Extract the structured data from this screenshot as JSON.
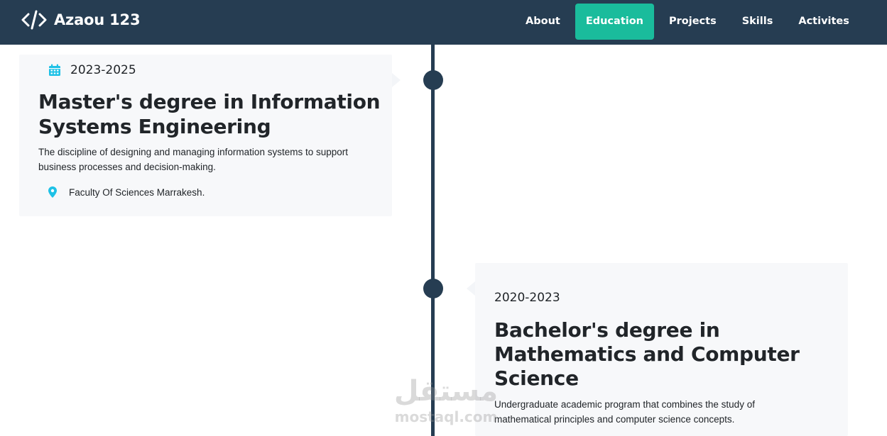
{
  "header": {
    "brand": "Azaou 123",
    "brand_icon": "code-icon",
    "nav": [
      {
        "label": "About",
        "active": false
      },
      {
        "label": "Education",
        "active": true
      },
      {
        "label": "Projects",
        "active": false
      },
      {
        "label": "Skills",
        "active": false
      },
      {
        "label": "Activites",
        "active": false
      }
    ]
  },
  "timeline": {
    "items": [
      {
        "date": "2023-2025",
        "date_icon": "calendar-icon",
        "title_lines": [
          "Master's degree in Information",
          "Systems Engineering"
        ],
        "description_lines": [
          "The discipline of designing and managing information systems to support",
          "business processes and decision-making."
        ],
        "location": "Faculty Of Sciences Marrakesh.",
        "location_icon": "map-marker-icon"
      },
      {
        "date": "2020-2023",
        "title_lines": [
          "Bachelor's degree in",
          "Mathematics and Computer",
          "Science"
        ],
        "description_lines": [
          "Undergraduate academic program that combines the study of",
          "mathematical principles and computer science concepts."
        ]
      }
    ]
  },
  "watermark": {
    "main": "مستقل",
    "sub": "mostaql.com"
  },
  "colors": {
    "navbar": "#263d52",
    "accent": "#1abc9c",
    "icon": "#1ec1e6",
    "card": "#f7f8fa"
  }
}
